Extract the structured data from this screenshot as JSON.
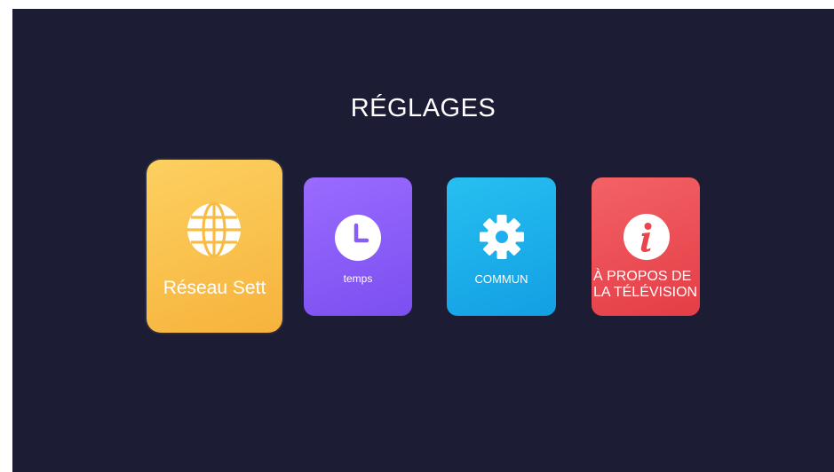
{
  "page": {
    "title": "RÉGLAGES"
  },
  "tiles": [
    {
      "id": "network",
      "label": "Réseau Sett",
      "icon": "globe-icon",
      "color": "#f9bf48",
      "focused": true
    },
    {
      "id": "time",
      "label": "temps",
      "icon": "clock-icon",
      "color": "#8a5cf6"
    },
    {
      "id": "general",
      "label": "COMMUN",
      "icon": "gear-icon",
      "color": "#1eaff0"
    },
    {
      "id": "about",
      "label_lines": [
        "À PROPOS DE",
        "LA TÉLÉVISION"
      ],
      "icon": "info-icon",
      "color": "#ea4b52"
    }
  ],
  "colors": {
    "background": "#1c1c35",
    "text": "#ffffff"
  }
}
